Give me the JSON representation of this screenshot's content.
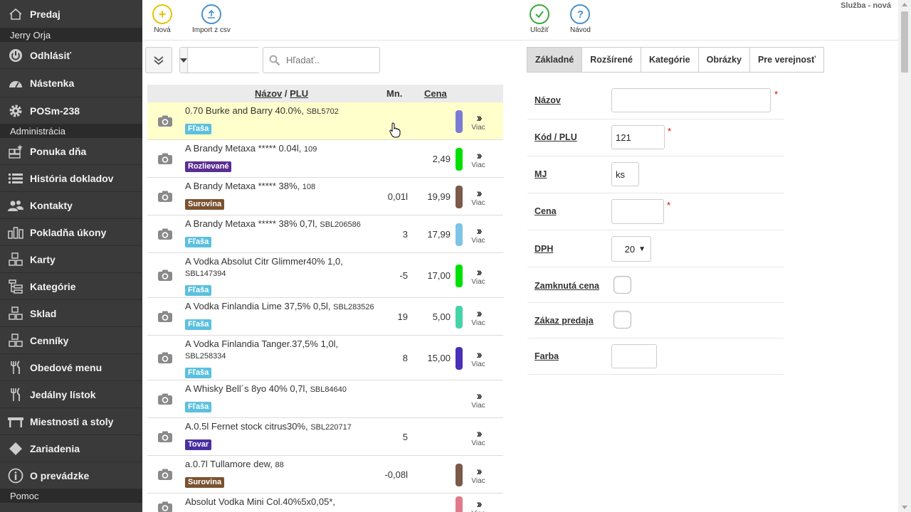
{
  "sidebar": {
    "predaj": "Predaj",
    "user_header": "Jerry Orja",
    "logout": "Odhlásiť",
    "dashboard": "Nástenka",
    "device": "POSm-238",
    "admin_header": "Administrácia",
    "items": [
      {
        "label": "Ponuka dňa",
        "icon": "daily-offer-icon"
      },
      {
        "label": "História dokladov",
        "icon": "list-icon"
      },
      {
        "label": "Kontakty",
        "icon": "users-icon"
      },
      {
        "label": "Pokladňa úkony",
        "icon": "bar-chart-icon"
      },
      {
        "label": "Karty",
        "icon": "boxes-icon"
      },
      {
        "label": "Kategórie",
        "icon": "tree-icon"
      },
      {
        "label": "Sklad",
        "icon": "warehouse-icon"
      },
      {
        "label": "Cenníky",
        "icon": "price-list-icon"
      },
      {
        "label": "Obedové menu",
        "icon": "fork-knife-icon"
      },
      {
        "label": "Jedálny lístok",
        "icon": "fork-knife-icon"
      },
      {
        "label": "Miestnosti a stoly",
        "icon": "table-icon"
      },
      {
        "label": "Zariadenia",
        "icon": "diamond-icon"
      },
      {
        "label": "O prevádzke",
        "icon": "info-icon"
      }
    ],
    "help_header": "Pomoc"
  },
  "toolbar": {
    "new_label": "Nová",
    "import_label": "Import z csv",
    "save_label": "Uložiť",
    "help_label": "Návod",
    "service": "Služba - nová"
  },
  "filters": {
    "search_placeholder": "Hľadať.."
  },
  "table": {
    "col_name": "Názov",
    "col_sep": " / ",
    "col_plu": "PLU",
    "col_qty": "Mn.",
    "col_price": "Cena",
    "more_label": "Viac",
    "rows": [
      {
        "name": "0.70 Burke and Barry 40.0%,",
        "plu": "SBL5702",
        "badge": "Fľaša",
        "badge_color": "#5bc0de",
        "qty": "",
        "price": "",
        "color": "#7b7bd6",
        "highlight": true
      },
      {
        "name": "A Brandy Metaxa ***** 0.04l,",
        "plu": "109",
        "badge": "Rozlievané",
        "badge_color": "#5a2d91",
        "qty": "",
        "price": "2,49",
        "color": "#00e000"
      },
      {
        "name": "A Brandy Metaxa ***** 38%,",
        "plu": "108",
        "badge": "Surovina",
        "badge_color": "#7a5230",
        "qty": "0,01l",
        "price": "19,99",
        "color": "#7a5a48"
      },
      {
        "name": "A Brandy Metaxa ***** 38% 0,7l,",
        "plu": "SBL206586",
        "badge": "Fľaša",
        "badge_color": "#5bc0de",
        "qty": "3",
        "price": "17,99",
        "color": "#7ec4e8"
      },
      {
        "name": "A Vodka Absolut Citr Glimmer40% 1,0,",
        "plu": "SBL147394",
        "badge": "Fľaša",
        "badge_color": "#5bc0de",
        "qty": "-5",
        "price": "17,00",
        "color": "#00e000"
      },
      {
        "name": "A Vodka Finlandia Lime 37,5% 0,5l,",
        "plu": "SBL283526",
        "badge": "Fľaša",
        "badge_color": "#5bc0de",
        "qty": "19",
        "price": "5,00",
        "color": "#44d4a8"
      },
      {
        "name": "A Vodka Finlandia Tanger.37,5% 1,0l,",
        "plu": "SBL258334",
        "badge": "Fľaša",
        "badge_color": "#5bc0de",
        "qty": "8",
        "price": "15,00",
        "color": "#4a2fb8"
      },
      {
        "name": "A Whisky Bell´s 8yo 40% 0,7l,",
        "plu": "SBL84640",
        "badge": "Fľaša",
        "badge_color": "#5bc0de",
        "qty": "",
        "price": "",
        "color": ""
      },
      {
        "name": "A.0.5l Fernet stock citrus30%,",
        "plu": "SBL220717",
        "badge": "Tovar",
        "badge_color": "#4a2fa0",
        "qty": "5",
        "price": "",
        "color": ""
      },
      {
        "name": "a.0.7l Tullamore dew,",
        "plu": "88",
        "badge": "Surovina",
        "badge_color": "#7a5230",
        "qty": "-0,08l",
        "price": "",
        "color": "#7a5a48"
      },
      {
        "name": "Absolut Vodka Mini Col.40%5x0,05*,",
        "plu": "",
        "badge": "",
        "badge_color": "",
        "qty": "",
        "price": "",
        "color": "#e07a8a"
      }
    ]
  },
  "tabs": [
    "Základné",
    "Rozšírené",
    "Kategórie",
    "Obrázky",
    "Pre verejnosť"
  ],
  "form": {
    "name_label": "Názov",
    "name_value": "",
    "code_label": "Kód / PLU",
    "code_value": "121",
    "unit_label": "MJ",
    "unit_value": "ks",
    "price_label": "Cena",
    "price_value": "",
    "vat_label": "DPH",
    "vat_value": "20",
    "locked_label": "Zamknutá cena",
    "ban_label": "Zákaz predaja",
    "color_label": "Farba",
    "required_mark": "*"
  },
  "colors": {
    "sidebar_bg": "#3a3a3a",
    "new_icon": "#e6c200",
    "import_icon": "#4a90c8",
    "save_icon": "#3aa83a",
    "help_icon": "#4a90c8",
    "highlight_row": "#ffffcc"
  }
}
